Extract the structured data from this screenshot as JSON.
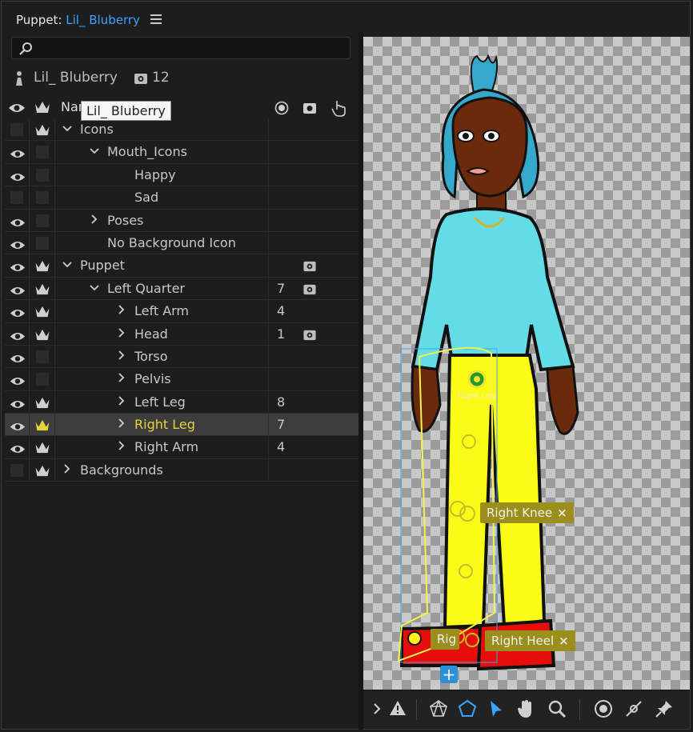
{
  "header": {
    "prefix": "Puppet: ",
    "puppet_name": "Lil_ Bluberry"
  },
  "search": {
    "placeholder": ""
  },
  "puppet": {
    "name": "Lil_ Bluberry",
    "camera_count": "12"
  },
  "columns": {
    "name": "Name",
    "tooltip": "Lil_ Bluberry"
  },
  "tree": [
    {
      "label": "Icons",
      "num": "",
      "cam": false
    },
    {
      "label": "Mouth_Icons",
      "num": "",
      "cam": false
    },
    {
      "label": "Happy",
      "num": "",
      "cam": false
    },
    {
      "label": "Sad",
      "num": "",
      "cam": false
    },
    {
      "label": "Poses",
      "num": "",
      "cam": false
    },
    {
      "label": "No Background Icon",
      "num": "",
      "cam": false
    },
    {
      "label": "Puppet",
      "num": "",
      "cam": true
    },
    {
      "label": "Left Quarter",
      "num": "7",
      "cam": true
    },
    {
      "label": "Left Arm",
      "num": "4",
      "cam": false
    },
    {
      "label": "Head",
      "num": "1",
      "cam": true
    },
    {
      "label": "Torso",
      "num": "",
      "cam": false
    },
    {
      "label": "Pelvis",
      "num": "",
      "cam": false
    },
    {
      "label": "Left Leg",
      "num": "8",
      "cam": false
    },
    {
      "label": "Right Leg",
      "num": "7",
      "cam": false
    },
    {
      "label": "Right Arm",
      "num": "4",
      "cam": false
    },
    {
      "label": "Backgrounds",
      "num": "",
      "cam": false
    }
  ],
  "canvas": {
    "handle_labels": {
      "right_leg": "Right Leg",
      "right_knee": "Right Knee",
      "right_toe": "Rig",
      "right_heel": "Right Heel"
    }
  },
  "colors": {
    "accent": "#3ba3ff",
    "selection": "#e6d43a",
    "handle": "#9c8e1a"
  }
}
